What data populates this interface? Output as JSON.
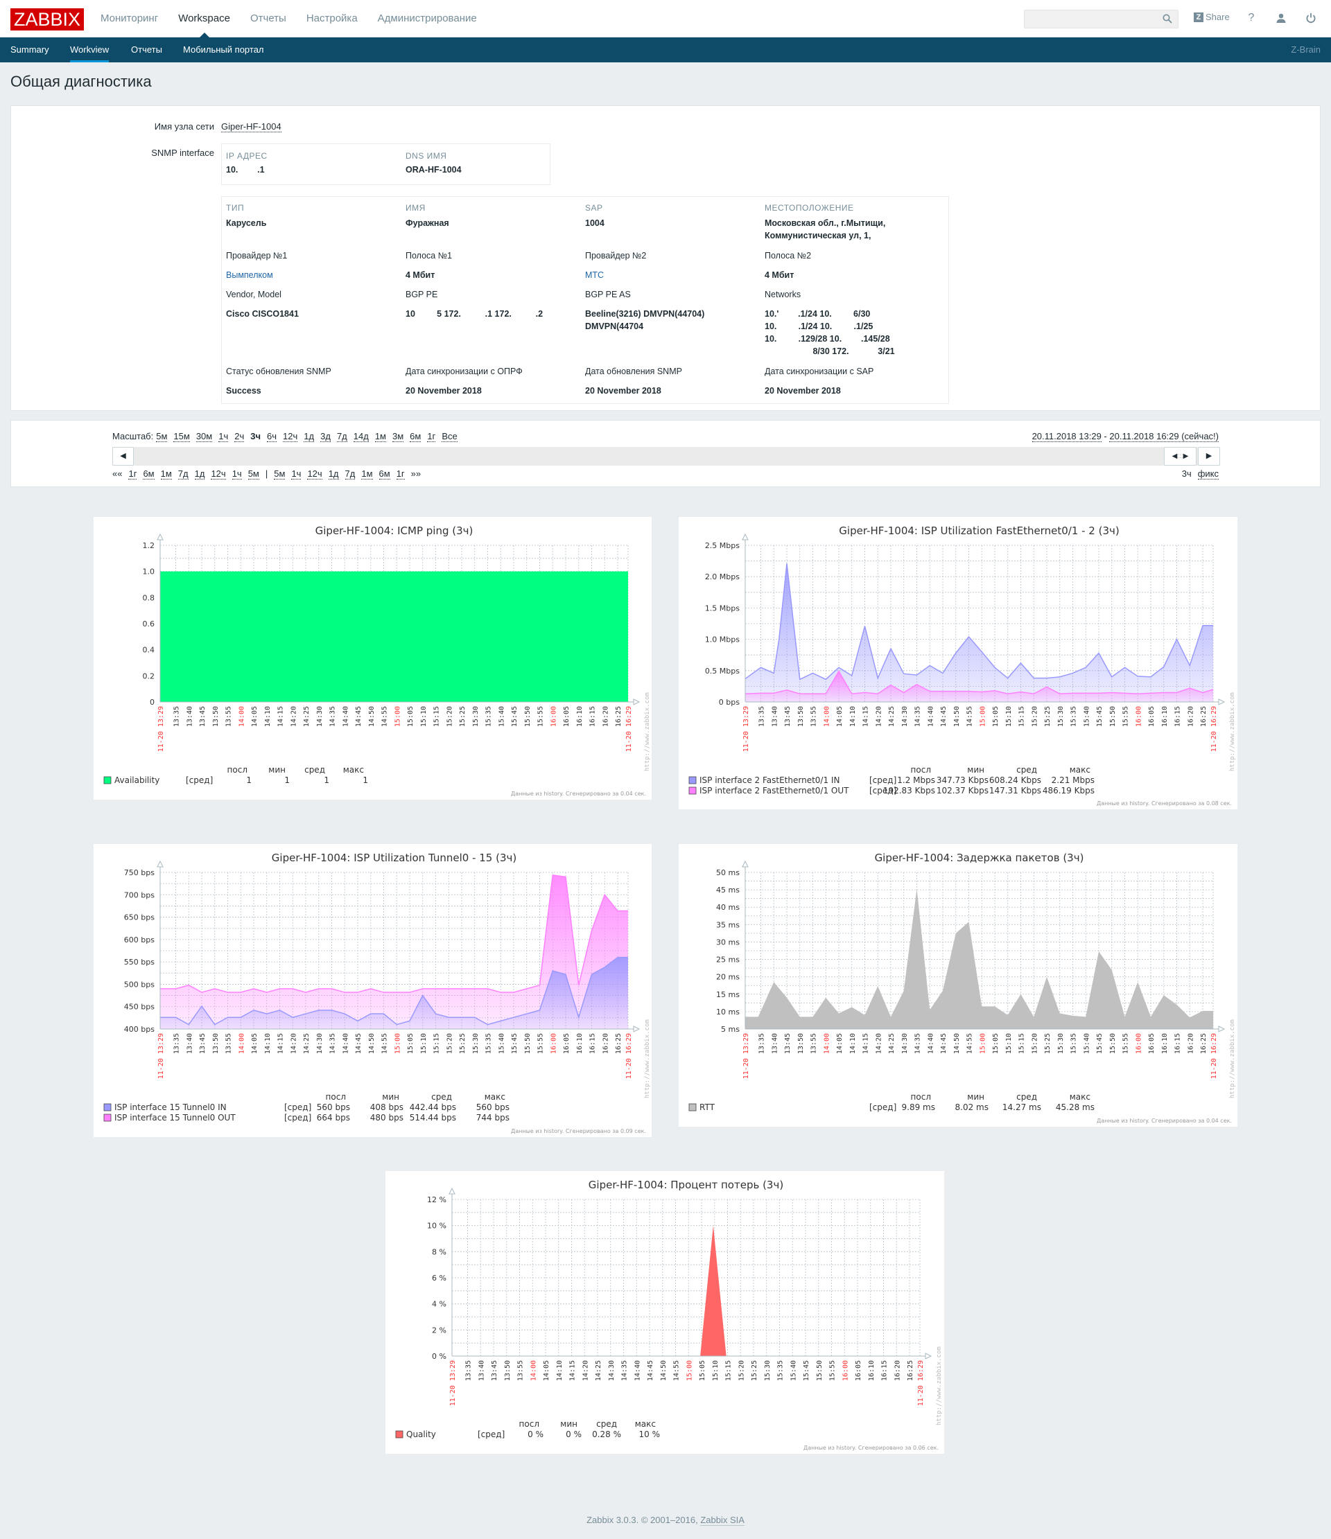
{
  "header": {
    "logo": "ZABBIX",
    "nav": [
      {
        "label": "Мониторинг",
        "active": false
      },
      {
        "label": "Workspace",
        "active": true
      },
      {
        "label": "Отчеты",
        "active": false
      },
      {
        "label": "Настройка",
        "active": false
      },
      {
        "label": "Администрирование",
        "active": false
      }
    ],
    "search_value": "",
    "share_label": "Share",
    "icons": [
      "search-icon",
      "help-icon",
      "user-icon",
      "logout-icon"
    ]
  },
  "subnav": {
    "items": [
      {
        "label": "Summary",
        "active": false
      },
      {
        "label": "Workview",
        "active": true
      },
      {
        "label": "Отчеты",
        "active": false
      },
      {
        "label": "Мобильный портал",
        "active": false
      }
    ],
    "right": "Z-Brain"
  },
  "page_title": "Общая диагностика",
  "host": {
    "host_label": "Имя узла сети",
    "host_name": "Giper-HF-1004",
    "snmp_label": "SNMP interface",
    "ip_caption": "IP АДРЕС",
    "ip_value": "10.        .1",
    "dns_caption": "DNS ИМЯ",
    "dns_value": "ORA-HF-1004",
    "inventory": {
      "type_caption": "ТИП",
      "type_value": "Карусель",
      "name_caption": "ИМЯ",
      "name_value": "Фуражная",
      "sap_caption": "SAP",
      "sap_value": "1004",
      "location_caption": "МЕСТОПОЛОЖЕНИЕ",
      "location_line1": "Московская обл., г.Мытищи,",
      "location_line2": "Коммунистическая ул, 1,",
      "provider1_label": "Провайдер №1",
      "provider1_value": "Вымпелком",
      "band1_label": "Полоса №1",
      "band1_value": "4 Мбит",
      "provider2_label": "Провайдер №2",
      "provider2_value": "МТС",
      "band2_label": "Полоса №2",
      "band2_value": "4 Мбит",
      "vendor_label": "Vendor, Model",
      "vendor_value": "Cisco CISCO1841",
      "bgp_pe_label": "BGP PE",
      "bgp_pe_value": "10         5 172.          .1 172.          .2",
      "bgp_as_label": "BGP PE AS",
      "bgp_as_line1": "Beeline(3216) DMVPN(44704)",
      "bgp_as_line2": "DMVPN(44704",
      "networks_label": "Networks",
      "networks_lines": [
        "10.'        .1/24 10.         6/30",
        "10.         .1/24 10.         .1/25",
        "10.         .129/28 10.        .145/28",
        "                    8/30 172.            3/21"
      ],
      "snmp_status_label": "Статус обновления SNMP",
      "snmp_status_value": "Success",
      "oprf_label": "Дата синхронизации с ОПРФ",
      "oprf_value": "20 November 2018",
      "snmp_date_label": "Дата обновления SNMP",
      "snmp_date_value": "20 November 2018",
      "sap_sync_label": "Дата синхронизации с SAP",
      "sap_sync_value": "20 November 2018"
    }
  },
  "timescale": {
    "zoom_label": "Масштаб:",
    "zoom_options": [
      "5м",
      "15м",
      "30м",
      "1ч",
      "2ч",
      "3ч",
      "6ч",
      "12ч",
      "1д",
      "3д",
      "7д",
      "14д",
      "1м",
      "3м",
      "6м",
      "1г",
      "Все"
    ],
    "zoom_selected": "3ч",
    "period_from": "20.11.2018 13:29",
    "period_sep": " - ",
    "period_to": "20.11.2018 16:29 (сейчас!)",
    "back_label": "««",
    "back_options": [
      "1г",
      "6м",
      "1м",
      "7д",
      "1д",
      "12ч",
      "1ч",
      "5м"
    ],
    "separator": "|",
    "fwd_options": [
      "5м",
      "1ч",
      "12ч",
      "1д",
      "7д",
      "1м",
      "6м",
      "1г"
    ],
    "fwd_label": "»»",
    "period_length": "3ч",
    "fixed_label": "фикс"
  },
  "footer": {
    "text": "Zabbix 3.0.3. © 2001–2016, ",
    "link": "Zabbix SIA"
  },
  "chart_data": [
    {
      "type": "area",
      "title": "Giper-HF-1004: ICMP ping (3ч)",
      "ylim": [
        0,
        1.2
      ],
      "yticks": [
        "0",
        "0.2",
        "0.4",
        "0.6",
        "0.8",
        "1.0",
        "1.2"
      ],
      "ytick_values": [
        0,
        0.2,
        0.4,
        0.6,
        0.8,
        1.0,
        1.2
      ],
      "x_minutes_range": [
        0,
        180
      ],
      "series": [
        {
          "name": "Availability",
          "color": "#00ff80",
          "fill": "solid",
          "func": "[сред]",
          "x": [
            0,
            180
          ],
          "values": [
            1,
            1
          ],
          "stats": {
            "last": "1",
            "min": "1",
            "avg": "1",
            "max": "1"
          }
        }
      ],
      "footnote": "Данные из history. Сгенерировано за 0.04 сек."
    },
    {
      "type": "area",
      "title": "Giper-HF-1004: ISP Utilization FastEthernet0/1 - 2 (3ч)",
      "ylim": [
        0,
        2.5
      ],
      "yticks": [
        "0 bps",
        "0.5 Mbps",
        "1.0 Mbps",
        "1.5 Mbps",
        "2.0 Mbps",
        "2.5 Mbps"
      ],
      "ytick_values": [
        0,
        0.5,
        1.0,
        1.5,
        2.0,
        2.5
      ],
      "y_unit": "Mbps",
      "x_minutes_range": [
        0,
        180
      ],
      "series": [
        {
          "name": "ISP interface 2 FastEthernet0/1 IN",
          "color": "#9999ff",
          "fill": "gradient",
          "func": "[сред]",
          "x": [
            0,
            6,
            11,
            13,
            16,
            21,
            26,
            31,
            36,
            41,
            46,
            51,
            56,
            61,
            66,
            71,
            76,
            81,
            86,
            91,
            96,
            101,
            106,
            111,
            116,
            121,
            126,
            131,
            136,
            141,
            146,
            151,
            156,
            161,
            166,
            171,
            176,
            180
          ],
          "values": [
            0.37,
            0.55,
            0.46,
            1.0,
            2.21,
            0.36,
            0.46,
            0.36,
            0.55,
            0.42,
            1.21,
            0.38,
            0.85,
            0.45,
            0.43,
            0.58,
            0.46,
            0.78,
            1.04,
            0.8,
            0.55,
            0.38,
            0.62,
            0.38,
            0.38,
            0.4,
            0.46,
            0.55,
            0.78,
            0.4,
            0.55,
            0.41,
            0.4,
            0.56,
            1.0,
            0.58,
            1.22,
            1.22
          ],
          "stats": {
            "last": "1.2 Mbps",
            "min": "347.73 Kbps",
            "avg": "608.24 Kbps",
            "max": "2.21 Mbps"
          }
        },
        {
          "name": "ISP interface 2 FastEthernet0/1 OUT",
          "color": "#ff80ff",
          "fill": "gradient",
          "func": "[сред]",
          "x": [
            0,
            6,
            11,
            16,
            21,
            26,
            31,
            36,
            41,
            46,
            51,
            56,
            61,
            66,
            71,
            76,
            81,
            86,
            91,
            96,
            101,
            106,
            111,
            116,
            121,
            126,
            131,
            136,
            141,
            146,
            151,
            156,
            161,
            166,
            171,
            176,
            180
          ],
          "values": [
            0.13,
            0.14,
            0.14,
            0.19,
            0.13,
            0.13,
            0.13,
            0.49,
            0.13,
            0.15,
            0.13,
            0.27,
            0.15,
            0.28,
            0.17,
            0.17,
            0.17,
            0.17,
            0.16,
            0.18,
            0.13,
            0.16,
            0.13,
            0.24,
            0.13,
            0.14,
            0.14,
            0.14,
            0.15,
            0.14,
            0.13,
            0.14,
            0.15,
            0.15,
            0.22,
            0.15,
            0.2
          ],
          "stats": {
            "last": "192.83 Kbps",
            "min": "102.37 Kbps",
            "avg": "147.31 Kbps",
            "max": "486.19 Kbps"
          }
        }
      ],
      "footnote": "Данные из history. Сгенерировано за 0.08 сек."
    },
    {
      "type": "area",
      "title": "Giper-HF-1004: ISP Utilization Tunnel0 - 15 (3ч)",
      "ylim": [
        400,
        750
      ],
      "yticks": [
        "400 bps",
        "450 bps",
        "500 bps",
        "550 bps",
        "600 bps",
        "650 bps",
        "700 bps",
        "750 bps"
      ],
      "ytick_values": [
        400,
        450,
        500,
        550,
        600,
        650,
        700,
        750
      ],
      "y_unit": "bps",
      "x_minutes_range": [
        0,
        180
      ],
      "series": [
        {
          "name": "ISP interface 15 Tunnel0 OUT",
          "color": "#ff80ff",
          "fill": "gradient",
          "func": "[сред]",
          "x": [
            0,
            6,
            11,
            16,
            21,
            26,
            31,
            36,
            41,
            46,
            51,
            56,
            61,
            66,
            71,
            76,
            81,
            86,
            91,
            96,
            101,
            106,
            111,
            116,
            121,
            126,
            131,
            136,
            141,
            146,
            151,
            156,
            161,
            166,
            171,
            176,
            180
          ],
          "values": [
            490,
            490,
            498,
            482,
            490,
            482,
            482,
            490,
            482,
            490,
            490,
            482,
            490,
            490,
            482,
            482,
            490,
            482,
            482,
            482,
            490,
            490,
            490,
            490,
            490,
            490,
            482,
            482,
            490,
            498,
            744,
            740,
            498,
            620,
            700,
            664,
            664
          ],
          "stats": {
            "last": "664 bps",
            "min": "480 bps",
            "avg": "514.44 bps",
            "max": "744 bps"
          }
        },
        {
          "name": "ISP interface 15 Tunnel0 IN",
          "color": "#9999ff",
          "fill": "gradient",
          "func": "[сред]",
          "x": [
            0,
            6,
            11,
            16,
            21,
            26,
            31,
            36,
            41,
            46,
            51,
            56,
            61,
            66,
            71,
            76,
            81,
            86,
            91,
            96,
            101,
            106,
            111,
            116,
            121,
            126,
            131,
            136,
            141,
            146,
            151,
            156,
            161,
            166,
            171,
            176,
            180
          ],
          "values": [
            426,
            426,
            410,
            451,
            410,
            426,
            426,
            442,
            434,
            442,
            426,
            434,
            442,
            442,
            434,
            418,
            434,
            434,
            410,
            418,
            475,
            434,
            426,
            426,
            426,
            410,
            418,
            426,
            434,
            442,
            530,
            522,
            426,
            522,
            538,
            560,
            560
          ],
          "stats": {
            "last": "560 bps",
            "min": "408 bps",
            "avg": "442.44 bps",
            "max": "560 bps"
          }
        }
      ],
      "legend_order": [
        "ISP interface 15 Tunnel0 IN",
        "ISP interface 15 Tunnel0 OUT"
      ],
      "footnote": "Данные из history. Сгенерировано за 0.09 сек."
    },
    {
      "type": "area",
      "title": "Giper-HF-1004: Задержка пакетов (3ч)",
      "ylim": [
        5,
        50
      ],
      "yticks": [
        "5 ms",
        "10 ms",
        "15 ms",
        "20 ms",
        "25 ms",
        "30 ms",
        "35 ms",
        "40 ms",
        "45 ms",
        "50 ms"
      ],
      "ytick_values": [
        5,
        10,
        15,
        20,
        25,
        30,
        35,
        40,
        45,
        50
      ],
      "y_unit": "ms",
      "x_minutes_range": [
        0,
        180
      ],
      "series": [
        {
          "name": "RTT",
          "color": "#c0c0c0",
          "fill": "solid",
          "func": "[сред]",
          "x": [
            0,
            5,
            11,
            16,
            21,
            26,
            31,
            36,
            41,
            46,
            51,
            56,
            61,
            66,
            71,
            76,
            81,
            86,
            91,
            96,
            101,
            106,
            111,
            116,
            121,
            126,
            131,
            136,
            141,
            146,
            151,
            156,
            161,
            166,
            171,
            176,
            180
          ],
          "values": [
            8.5,
            8.5,
            18.5,
            14,
            8.5,
            8.5,
            14,
            9.5,
            11.3,
            9,
            17.3,
            8.5,
            16,
            45.3,
            10.5,
            16,
            32.5,
            35.8,
            11.5,
            11.5,
            9,
            15,
            8.5,
            20,
            9.5,
            8.8,
            8.5,
            27.3,
            22,
            8.5,
            18.5,
            8.5,
            14.7,
            12,
            8.3,
            10.2,
            10.2
          ],
          "stats": {
            "last": "9.89 ms",
            "min": "8.02 ms",
            "avg": "14.27 ms",
            "max": "45.28 ms"
          }
        }
      ],
      "footnote": "Данные из history. Сгенерировано за 0.04 сек."
    },
    {
      "type": "area",
      "title": "Giper-HF-1004: Процент потерь (3ч)",
      "ylim": [
        0,
        12
      ],
      "yticks": [
        "0 %",
        "2 %",
        "4 %",
        "6 %",
        "8 %",
        "10 %",
        "12 %"
      ],
      "ytick_values": [
        0,
        2,
        4,
        6,
        8,
        10,
        12
      ],
      "y_unit": "%",
      "x_minutes_range": [
        0,
        180
      ],
      "series": [
        {
          "name": "Quality",
          "color": "#ff6666",
          "fill": "solid",
          "func": "[сред]",
          "x": [
            0,
            95.5,
            100.5,
            105.5,
            180
          ],
          "values": [
            0,
            0,
            10,
            0,
            0
          ],
          "stats": {
            "last": "0 %",
            "min": "0 %",
            "avg": "0.28 %",
            "max": "10 %"
          }
        }
      ],
      "footnote": "Данные из history. Сгенерировано за 0.06 сек."
    }
  ],
  "chart_common": {
    "x_start_label": "11-20 13:29",
    "x_end_label": "11-20 16:29",
    "x_ticks": [
      "13:35",
      "13:40",
      "13:45",
      "13:50",
      "13:55",
      "14:00",
      "14:05",
      "14:10",
      "14:15",
      "14:20",
      "14:25",
      "14:30",
      "14:35",
      "14:40",
      "14:45",
      "14:50",
      "14:55",
      "15:00",
      "15:05",
      "15:10",
      "15:15",
      "15:20",
      "15:25",
      "15:30",
      "15:35",
      "15:40",
      "15:45",
      "15:50",
      "15:55",
      "16:00",
      "16:05",
      "16:10",
      "16:15",
      "16:20",
      "16:25"
    ],
    "x_major_ticks": [
      "14:00",
      "15:00",
      "16:00"
    ],
    "legend_headers": {
      "last": "посл",
      "min": "мин",
      "avg": "сред",
      "max": "макс"
    },
    "watermark": "http://www.zabbix.com"
  }
}
